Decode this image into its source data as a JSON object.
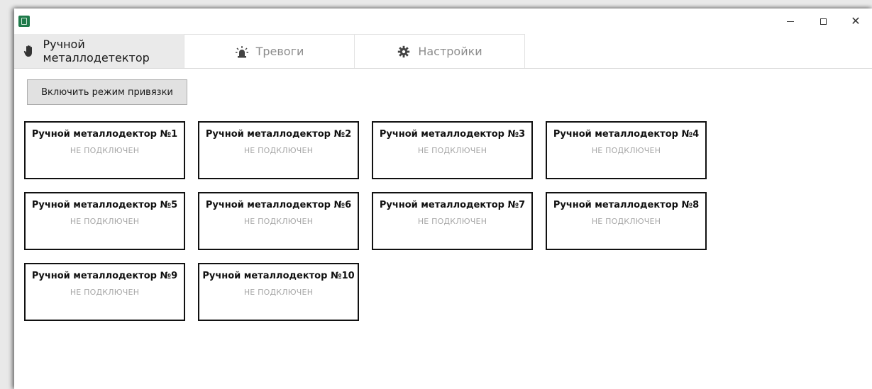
{
  "window": {
    "minimize_glyph": "–",
    "close_glyph": "✕"
  },
  "tabs": [
    {
      "label": "Ручной металлодетектор",
      "icon": "hand-icon",
      "active": true
    },
    {
      "label": "Тревоги",
      "icon": "alarm-light-icon",
      "active": false
    },
    {
      "label": "Настройки",
      "icon": "gear-icon",
      "active": false
    }
  ],
  "toolbar": {
    "bind_mode_label": "Включить режим привязки"
  },
  "devices": [
    {
      "name": "Ручной металлодектор №1",
      "status": "НЕ ПОДКЛЮЧЕН"
    },
    {
      "name": "Ручной металлодектор №2",
      "status": "НЕ ПОДКЛЮЧЕН"
    },
    {
      "name": "Ручной металлодектор №3",
      "status": "НЕ ПОДКЛЮЧЕН"
    },
    {
      "name": "Ручной металлодектор №4",
      "status": "НЕ ПОДКЛЮЧЕН"
    },
    {
      "name": "Ручной металлодектор №5",
      "status": "НЕ ПОДКЛЮЧЕН"
    },
    {
      "name": "Ручной металлодектор №6",
      "status": "НЕ ПОДКЛЮЧЕН"
    },
    {
      "name": "Ручной металлодектор №7",
      "status": "НЕ ПОДКЛЮЧЕН"
    },
    {
      "name": "Ручной металлодектор №8",
      "status": "НЕ ПОДКЛЮЧЕН"
    },
    {
      "name": "Ручной металлодектор №9",
      "status": "НЕ ПОДКЛЮЧЕН"
    },
    {
      "name": "Ручной металлодектор №10",
      "status": "НЕ ПОДКЛЮЧЕН"
    }
  ]
}
